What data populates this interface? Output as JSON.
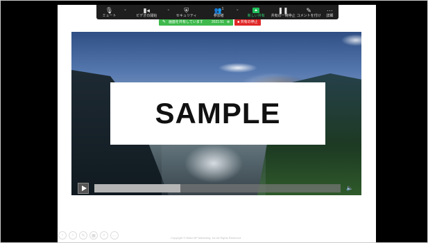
{
  "toolbar": {
    "items": [
      {
        "label": "ミュート",
        "icon": "microphone-icon",
        "glyph": "🎙"
      },
      {
        "label": "ビデオの開始",
        "icon": "video-camera-icon",
        "glyph": "▮◂"
      },
      {
        "label": "セキュリティ",
        "icon": "shield-icon",
        "glyph": "⛨"
      },
      {
        "label": "参加者",
        "icon": "participants-icon",
        "glyph": "👥",
        "count": "1"
      },
      {
        "label": "新しい共有",
        "icon": "share-screen-icon"
      },
      {
        "label": "共有の一時停止",
        "icon": "pause-icon",
        "glyph": "❚❚"
      },
      {
        "label": "コメントを付け",
        "icon": "pencil-icon",
        "glyph": "✎"
      },
      {
        "label": "詳細",
        "icon": "more-icon",
        "glyph": "···"
      }
    ]
  },
  "share_bar": {
    "status_text": "画面を共有しています",
    "meeting_id": "2021:51",
    "stop_label": "共有の停止"
  },
  "video": {
    "overlay_text": "SAMPLE",
    "progress": 0.35
  },
  "footer": {
    "copyright": "Copyright © Nikko BP Marketing, Inc All Rights Reserved."
  }
}
